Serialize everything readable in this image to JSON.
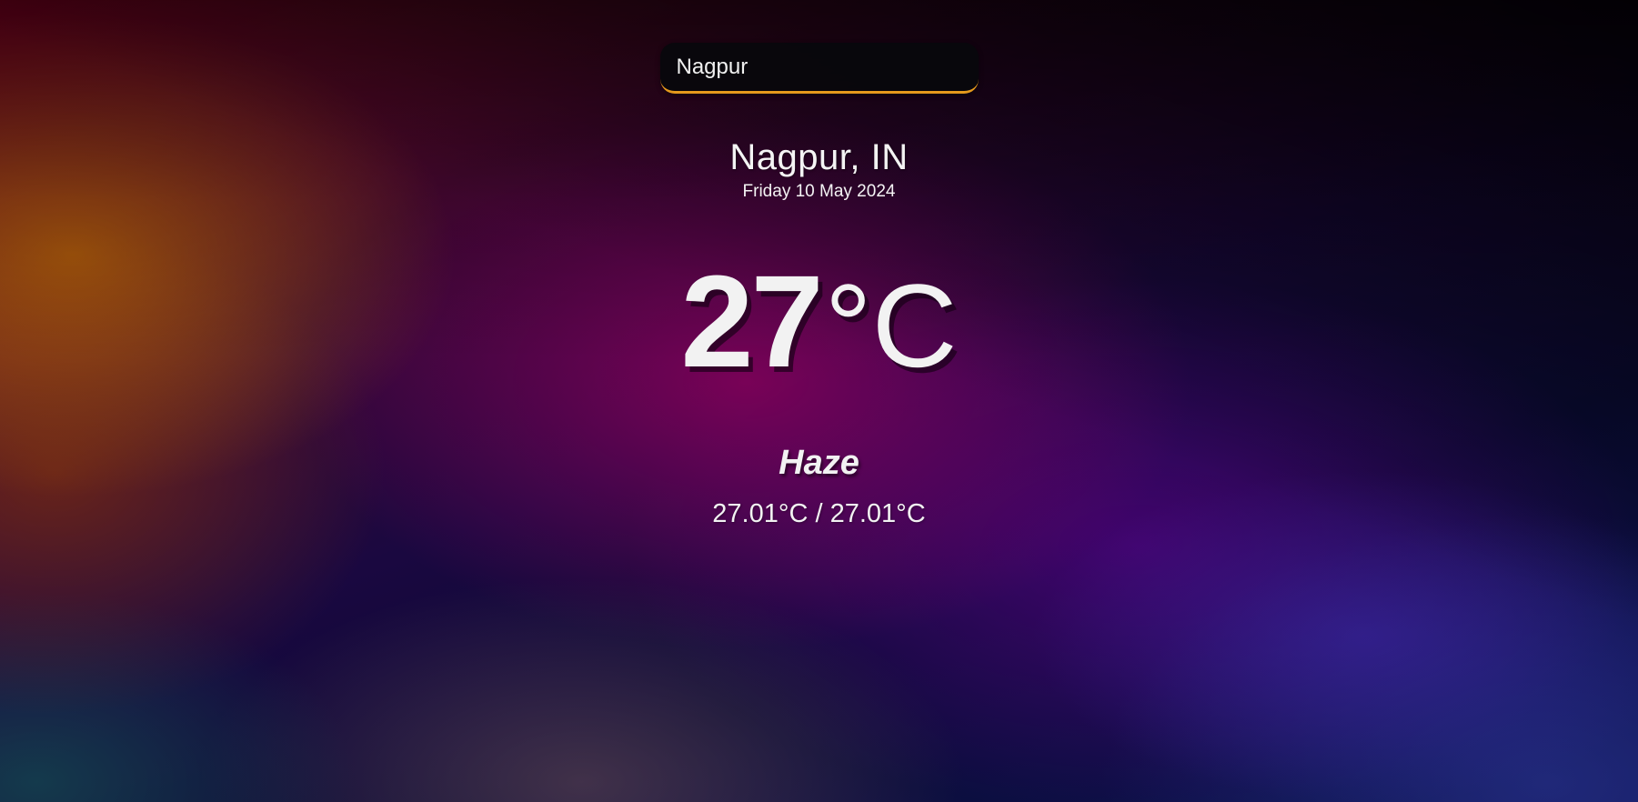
{
  "search": {
    "value": "Nagpur"
  },
  "location": {
    "city": "Nagpur, IN",
    "date": "Friday 10 May 2024"
  },
  "current": {
    "temperature": "27",
    "unit": "°C",
    "condition": "Haze",
    "range": "27.01°C / 27.01°C"
  },
  "colors": {
    "accent": "#e59a1c",
    "text": "#f2f2f2"
  }
}
